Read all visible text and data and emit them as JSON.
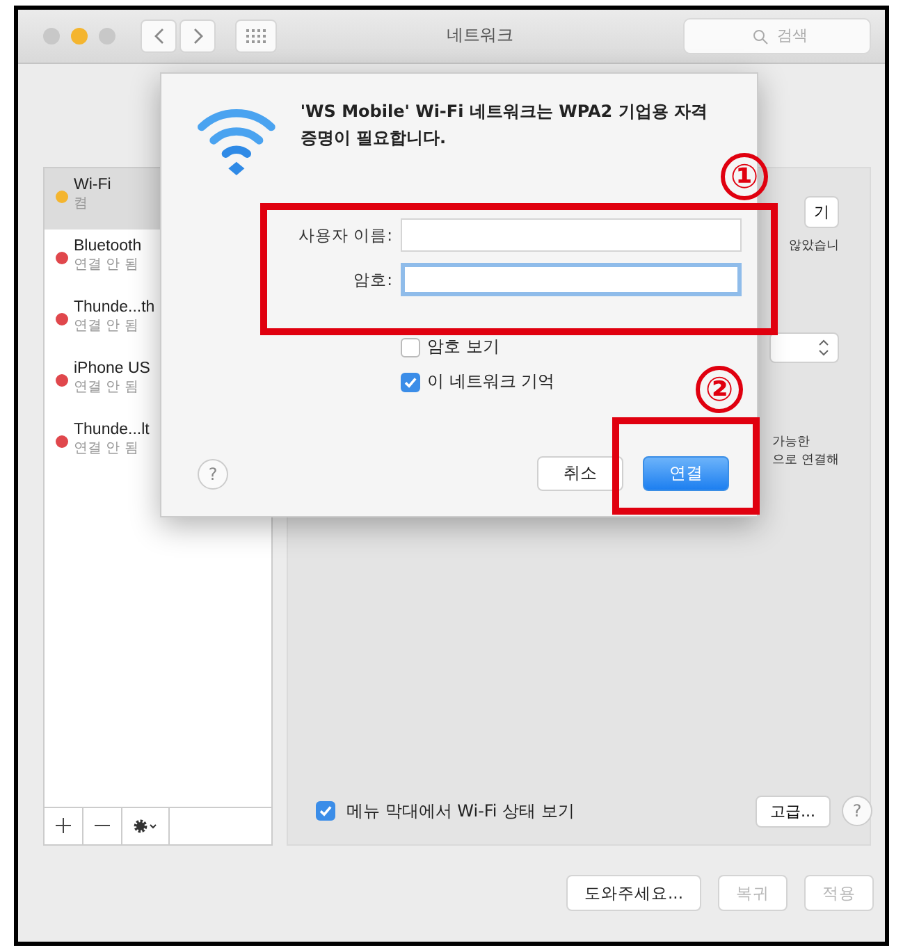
{
  "window": {
    "title": "네트워크",
    "search": {
      "placeholder": "검색"
    },
    "lights": [
      {
        "color": "#c8c8c8"
      },
      {
        "color": "#f4b52f"
      },
      {
        "color": "#c8c8c8"
      }
    ]
  },
  "sidebar": {
    "items": [
      {
        "name": "Wi-Fi",
        "status": "켬",
        "color": "#f4b52f",
        "selected": true
      },
      {
        "name": "Bluetooth",
        "status": "연결 안 됨",
        "color": "#e0474c",
        "selected": false
      },
      {
        "name": "Thunde...th",
        "status": "연결 안 됨",
        "color": "#e0474c",
        "selected": false
      },
      {
        "name": "iPhone US",
        "status": "연결 안 됨",
        "color": "#e0474c",
        "selected": false
      },
      {
        "name": "Thunde...lt",
        "status": "연결 안 됨",
        "color": "#e0474c",
        "selected": false
      }
    ]
  },
  "panel": {
    "button": "기",
    "status_text": "않았습니",
    "hint_lines": [
      "가능한",
      "으로 연결해"
    ],
    "show_status": {
      "label": "메뉴 막대에서 Wi-Fi 상태 보기",
      "checked": true
    },
    "advanced_button": "고급...",
    "help": "?"
  },
  "dialog": {
    "message": "'WS Mobile' Wi-Fi 네트워크는 WPA2 기업용 자격 증명이 필요합니다.",
    "fields": [
      {
        "label": "사용자 이름:",
        "focused": false
      },
      {
        "label": "암호:",
        "focused": true
      }
    ],
    "options": [
      {
        "label": "암호 보기",
        "checked": false
      },
      {
        "label": "이 네트워크 기억",
        "checked": true
      }
    ],
    "help": "?",
    "buttons": [
      {
        "label": "취소",
        "kind": "plain"
      },
      {
        "label": "연결",
        "kind": "default"
      }
    ]
  },
  "footer": {
    "buttons": [
      {
        "label": "도와주세요...",
        "disabled": false
      },
      {
        "label": "복귀",
        "disabled": true
      },
      {
        "label": "적용",
        "disabled": true
      }
    ]
  },
  "annotations": [
    {
      "label": "①"
    },
    {
      "label": "②"
    }
  ]
}
